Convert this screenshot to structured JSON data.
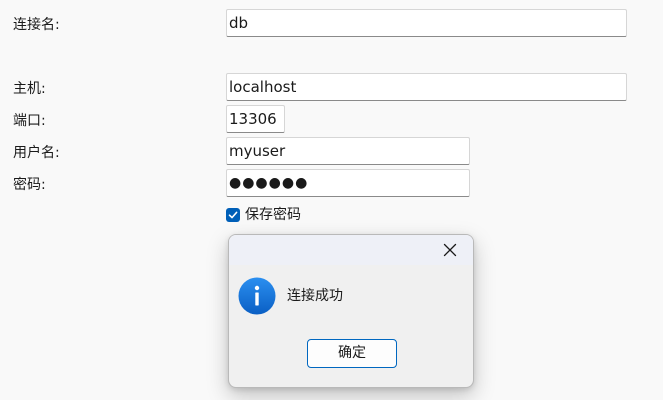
{
  "form": {
    "connection_name_label": "连接名:",
    "connection_name_value": "db",
    "host_label": "主机:",
    "host_value": "localhost",
    "port_label": "端口:",
    "port_value": "13306",
    "username_label": "用户名:",
    "username_value": "myuser",
    "password_label": "密码:",
    "password_value": "●●●●●●",
    "save_password_label": "保存密码",
    "save_password_checked": true
  },
  "dialog": {
    "message": "连接成功",
    "ok_label": "确定",
    "icon": "info-icon",
    "close_icon": "close-icon"
  },
  "colors": {
    "accent": "#005fb8",
    "info_icon": "#1a73d9",
    "ok_border": "#0067c0"
  }
}
